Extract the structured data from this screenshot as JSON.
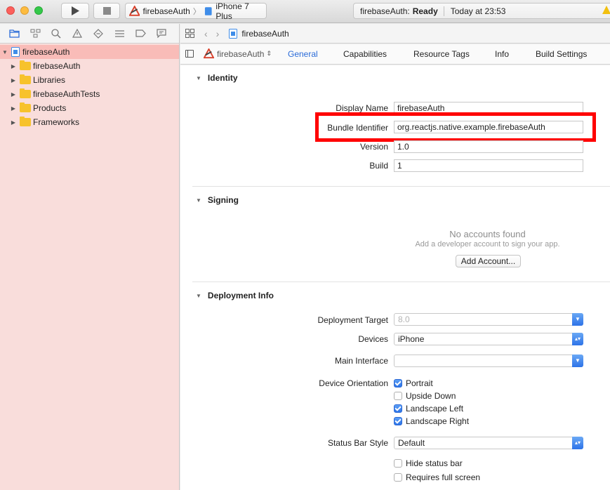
{
  "toolbar": {
    "scheme": "firebaseAuth",
    "device": "iPhone 7 Plus",
    "status_project": "firebaseAuth:",
    "status_state": "Ready",
    "status_time": "Today at 23:53"
  },
  "navigator": {
    "items": [
      {
        "label": "firebaseAuth",
        "selected": true
      },
      {
        "label": "firebaseAuth"
      },
      {
        "label": "Libraries"
      },
      {
        "label": "firebaseAuthTests"
      },
      {
        "label": "Products"
      },
      {
        "label": "Frameworks"
      }
    ]
  },
  "jumpbar": {
    "file": "firebaseAuth"
  },
  "tabs": {
    "target": "firebaseAuth",
    "items": [
      "General",
      "Capabilities",
      "Resource Tags",
      "Info",
      "Build Settings"
    ],
    "active": "General"
  },
  "identity": {
    "title": "Identity",
    "display_name_label": "Display Name",
    "display_name": "firebaseAuth",
    "bundle_id_label": "Bundle Identifier",
    "bundle_id": "org.reactjs.native.example.firebaseAuth",
    "version_label": "Version",
    "version": "1.0",
    "build_label": "Build",
    "build": "1"
  },
  "signing": {
    "title": "Signing",
    "no_accounts": "No accounts found",
    "hint": "Add a developer account to sign your app.",
    "add_account": "Add Account..."
  },
  "deployment": {
    "title": "Deployment Info",
    "target_label": "Deployment Target",
    "target": "8.0",
    "devices_label": "Devices",
    "devices": "iPhone",
    "main_interface_label": "Main Interface",
    "main_interface": "",
    "orientation_label": "Device Orientation",
    "orientations": [
      {
        "label": "Portrait",
        "checked": true
      },
      {
        "label": "Upside Down",
        "checked": false
      },
      {
        "label": "Landscape Left",
        "checked": true
      },
      {
        "label": "Landscape Right",
        "checked": true
      }
    ],
    "status_bar_label": "Status Bar Style",
    "status_bar": "Default",
    "hide_status_bar": "Hide status bar",
    "full_screen": "Requires full screen"
  },
  "colors": {
    "accent": "#2a6bd8",
    "highlight": "#ff0000",
    "selection": "#f9bcb8"
  }
}
